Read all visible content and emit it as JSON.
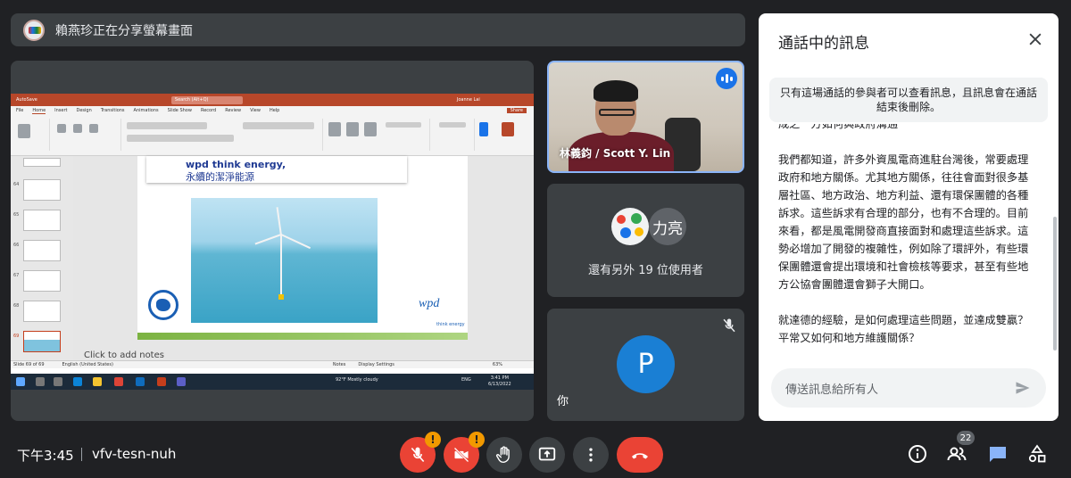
{
  "banner": {
    "text": "賴燕珍正在分享螢幕畫面"
  },
  "presentation": {
    "autosave": "AutoSave",
    "search": "Search (Alt+Q)",
    "user": "Joanne Lai",
    "share_label": "Share",
    "tabs": [
      "File",
      "Home",
      "Insert",
      "Design",
      "Transitions",
      "Animations",
      "Slide Show",
      "Record",
      "Review",
      "View",
      "Help"
    ],
    "slide_numbers": [
      "64",
      "65",
      "66",
      "67",
      "68",
      "69"
    ],
    "slide_title_1": "wpd think energy,",
    "slide_title_2": "永續的潔淨能源",
    "logo": "wpd",
    "logo_tagline": "think energy",
    "notes_placeholder": "Click to add notes",
    "status_left": "Slide 69 of 69",
    "status_lang": "English (United States)",
    "status_notes": "Notes",
    "status_display": "Display Settings",
    "zoom": "63%",
    "weather": "92°F Mostly cloudy",
    "lang_tray": "ENG",
    "time": "3:41 PM",
    "date": "6/13/2022"
  },
  "tiles": {
    "speaker_name": "林義鈞 / Scott Y. Lin",
    "avatar_initials": "力亮",
    "others_text": "還有另外 19 位使用者",
    "self_initial": "P",
    "self_label": "你"
  },
  "chat": {
    "title": "通話中的訊息",
    "notice": "只有這場通話的參與者可以查看訊息，且訊息會在通話結束後刪除。",
    "clipped_line": "成之一方如何與政府溝通",
    "message_1": "我們都知道，許多外資風電商進駐台灣後，常要處理政府和地方關係。尤其地方關係，往往會面對很多基層社區、地方政治、地方利益、還有環保團體的各種訴求。這些訴求有合理的部分，也有不合理的。目前來看，都是風電開發商直接面對和處理這些訴求。這勢必增加了開發的複雜性，例如除了環評外，有些環保團體還會提出環境和社會檢核等要求，甚至有些地方公協會團體還會獅子大開口。",
    "message_2": "就達德的經驗，是如何處理這些問題，並達成雙贏？平常又如何和地方維護關係？",
    "input_placeholder": "傳送訊息給所有人"
  },
  "bottom": {
    "time": "下午3:45",
    "meeting_code": "vfv-tesn-nuh",
    "mic_warning": "!",
    "cam_warning": "!",
    "participants_count": "22"
  },
  "colors": {
    "background": "#202124",
    "tile": "#3c4043",
    "accent_blue": "#1a73e8",
    "hangup_red": "#ea4335",
    "warning_orange": "#f29900"
  }
}
